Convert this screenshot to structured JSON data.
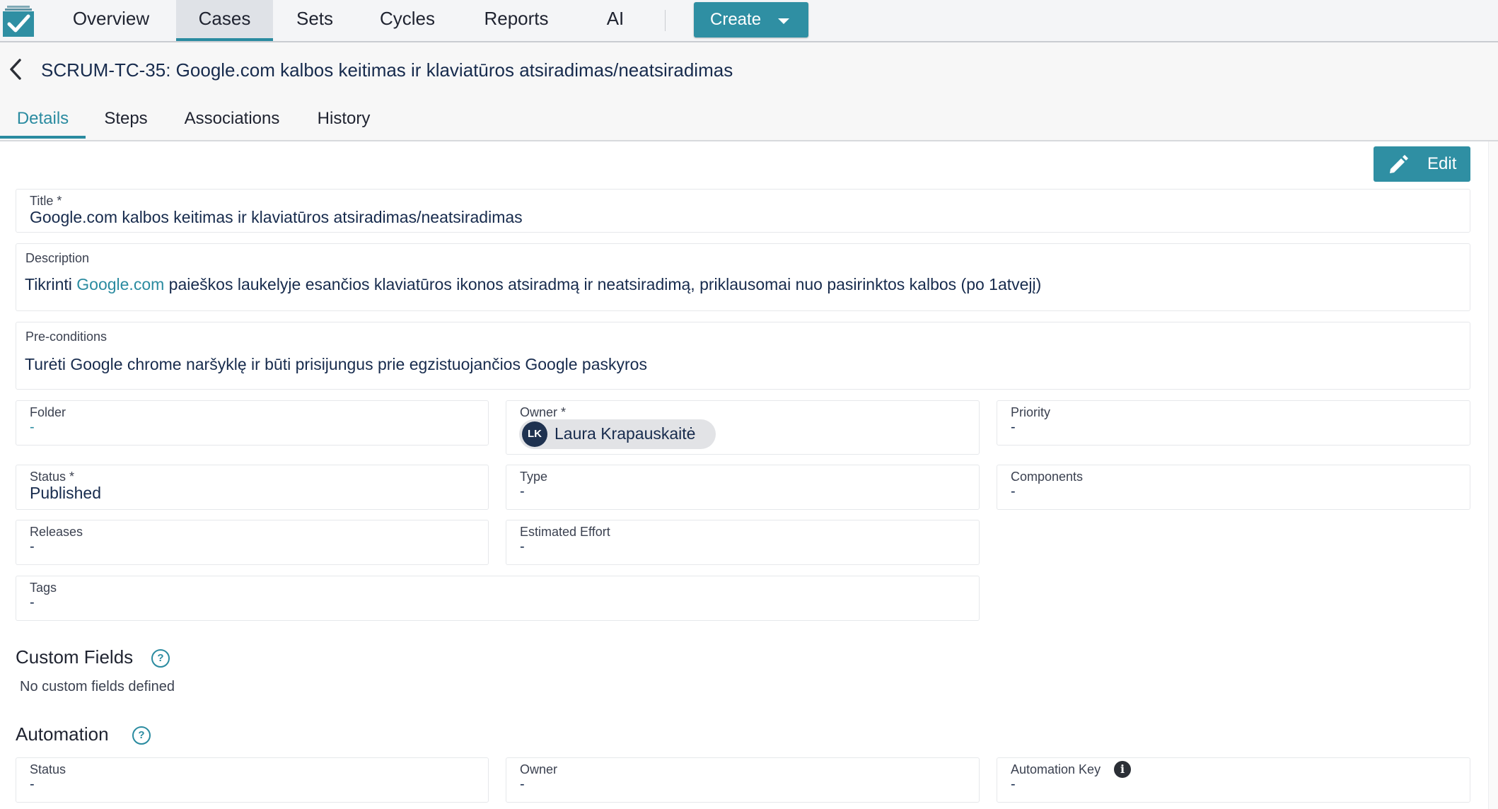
{
  "nav": {
    "tabs": [
      {
        "label": "Overview"
      },
      {
        "label": "Cases"
      },
      {
        "label": "Sets"
      },
      {
        "label": "Cycles"
      },
      {
        "label": "Reports"
      },
      {
        "label": "AI"
      }
    ],
    "active_tab": "Cases",
    "create_label": "Create"
  },
  "header": {
    "title": "SCRUM-TC-35: Google.com kalbos keitimas ir klaviatūros atsiradimas/neatsiradimas",
    "tabs": [
      {
        "label": "Details"
      },
      {
        "label": "Steps"
      },
      {
        "label": "Associations"
      },
      {
        "label": "History"
      }
    ],
    "active_tab": "Details"
  },
  "edit_label": "Edit",
  "fields": {
    "title": {
      "label": "Title *",
      "value": "Google.com kalbos keitimas ir klaviatūros atsiradimas/neatsiradimas"
    },
    "description": {
      "label": "Description",
      "before": "Tikrinti ",
      "link": "Google.com",
      "after": " paieškos laukelyje esančios klaviatūros ikonos atsiradmą ir neatsiradimą, priklausomai nuo pasirinktos kalbos (po 1atvejį)"
    },
    "preconditions": {
      "label": "Pre-conditions",
      "value": "Turėti Google chrome naršyklę ir būti prisijungus prie egzistuojančios Google paskyros"
    },
    "folder": {
      "label": "Folder",
      "value": "-"
    },
    "owner": {
      "label": "Owner *",
      "initials": "LK",
      "name": "Laura Krapauskaitė"
    },
    "priority": {
      "label": "Priority",
      "value": "-"
    },
    "status": {
      "label": "Status *",
      "value": "Published"
    },
    "type": {
      "label": "Type",
      "value": "-"
    },
    "components": {
      "label": "Components",
      "value": "-"
    },
    "releases": {
      "label": "Releases",
      "value": "-"
    },
    "estimated_effort": {
      "label": "Estimated Effort",
      "value": "-"
    },
    "tags": {
      "label": "Tags",
      "value": "-"
    }
  },
  "custom_fields": {
    "title": "Custom Fields",
    "help": "?",
    "note": "No custom fields defined"
  },
  "automation": {
    "title": "Automation",
    "help": "?",
    "status": {
      "label": "Status",
      "value": "-"
    },
    "owner": {
      "label": "Owner",
      "value": "-"
    },
    "key": {
      "label": "Automation Key",
      "value": "-",
      "info": "i"
    }
  },
  "colors": {
    "accent": "#2f8fa3",
    "link": "#2a8ba0",
    "avatar": "#1f3250"
  }
}
